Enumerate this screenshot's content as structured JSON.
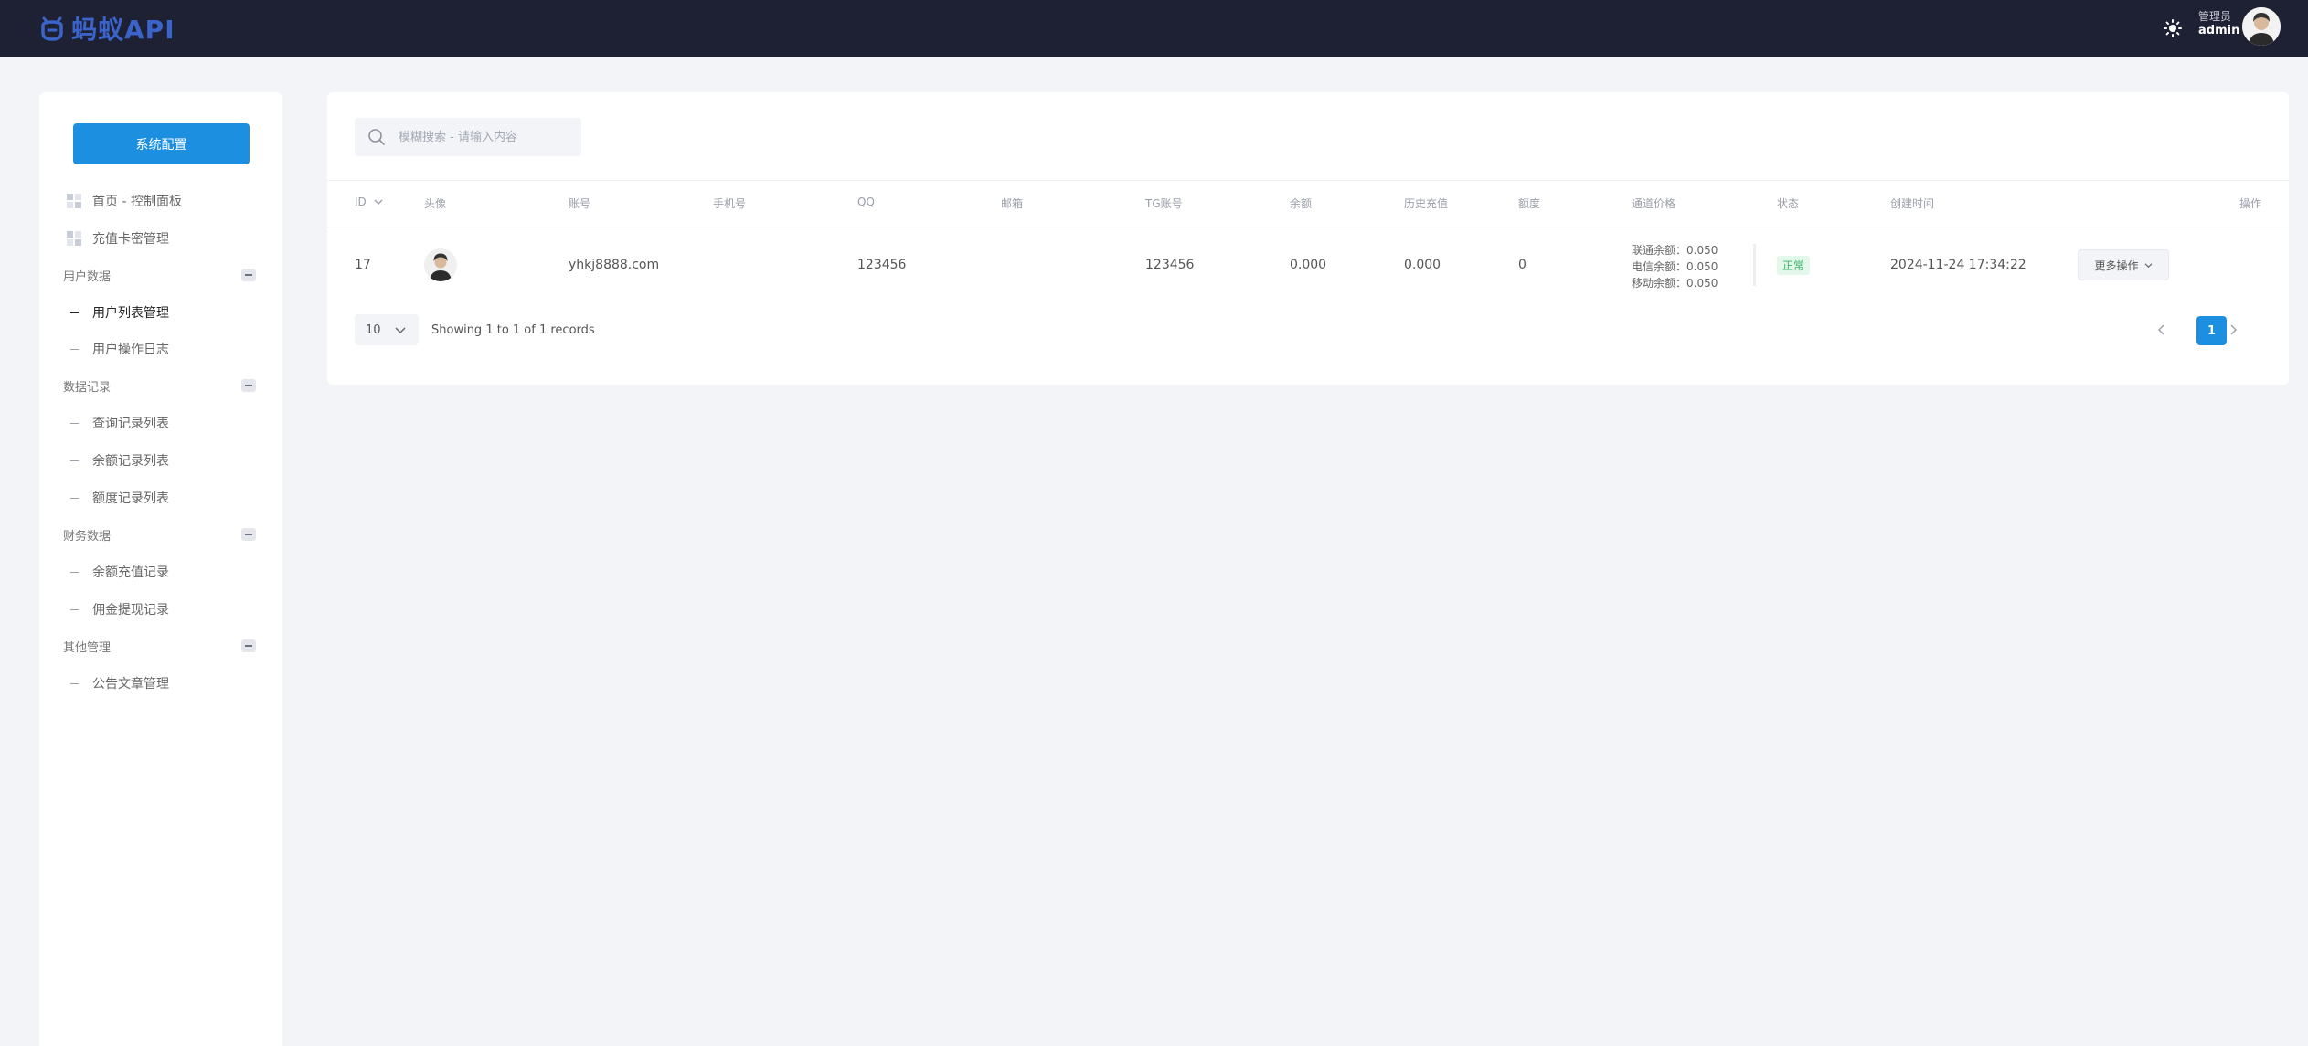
{
  "header": {
    "logo_text": "蚂蚁API",
    "user_role": "管理员",
    "user_name": "admin"
  },
  "sidebar": {
    "config_button": "系统配置",
    "top_items": [
      {
        "label": "首页 - 控制面板",
        "icon": "grid-icon"
      },
      {
        "label": "充值卡密管理",
        "icon": "grid-icon"
      }
    ],
    "groups": [
      {
        "label": "用户数据",
        "items": [
          "用户列表管理",
          "用户操作日志"
        ]
      },
      {
        "label": "数据记录",
        "items": [
          "查询记录列表",
          "余额记录列表",
          "额度记录列表"
        ]
      },
      {
        "label": "财务数据",
        "items": [
          "余额充值记录",
          "佣金提现记录"
        ]
      },
      {
        "label": "其他管理",
        "items": [
          "公告文章管理"
        ]
      }
    ],
    "active_item": "用户列表管理"
  },
  "search": {
    "placeholder": "模糊搜索 - 请输入内容"
  },
  "table": {
    "columns": [
      "ID",
      "头像",
      "账号",
      "手机号",
      "QQ",
      "邮箱",
      "TG账号",
      "余额",
      "历史充值",
      "额度",
      "通道价格",
      "状态",
      "创建时间",
      "操作"
    ],
    "rows": [
      {
        "id": "17",
        "account": "yhkj8888.com",
        "phone": "",
        "qq": "123456",
        "email": "",
        "tg": "123456",
        "balance": "0.000",
        "history_recharge": "0.000",
        "quota": "0",
        "prices": [
          "联通余额：0.050",
          "电信余额：0.050",
          "移动余额：0.050"
        ],
        "status": "正常",
        "created": "2024-11-24 17:34:22",
        "action": "更多操作"
      }
    ]
  },
  "pagination": {
    "page_size": "10",
    "records_text": "Showing 1 to 1 of 1 records",
    "current_page": "1"
  },
  "colors": {
    "topbar": "#1e2033",
    "primary": "#1d8fe1",
    "success": "#3bb36b",
    "page_bg": "#f2f4f7"
  }
}
